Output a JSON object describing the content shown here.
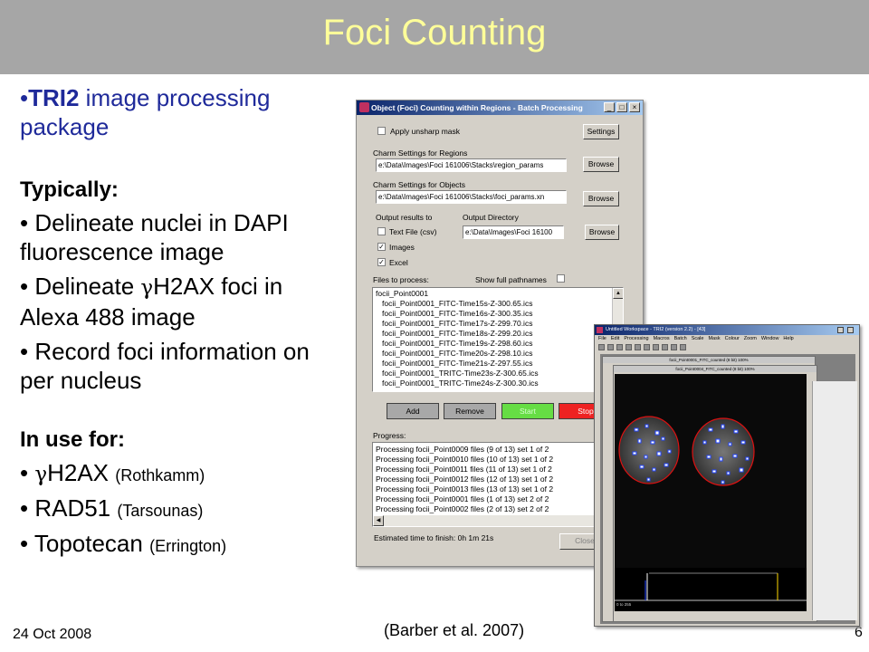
{
  "slide": {
    "title": "Foci Counting",
    "date": "24 Oct 2008",
    "citation": "(Barber et al. 2007)",
    "page_number": "6"
  },
  "left": {
    "intro_bullet": "•",
    "intro_bold": "TRI2",
    "intro_rest_1": " image processing",
    "intro_rest_2": "package",
    "typically_heading": "Typically:",
    "b1_line1": "• Delineate nuclei in DAPI",
    "b1_line2": "fluorescence image",
    "b2_prefix": "• Delineate ",
    "b2_gamma": "γ",
    "b2_rest": "H2AX foci in",
    "b2_line2": "Alexa 488 image",
    "b3_line1": "• Record foci information on",
    "b3_line2": "per nucleus",
    "inuse_heading": "In use for:",
    "u1_prefix": "• ",
    "u1_gamma": "γ",
    "u1_main": "H2AX ",
    "u1_small": "(Rothkamm)",
    "u2_main": "• RAD51 ",
    "u2_small": "(Tarsounas)",
    "u3_main": "• Topotecan ",
    "u3_small": "(Errington)"
  },
  "dialog": {
    "title": "Object (Foci) Counting within Regions - Batch Processing",
    "minimize": "_",
    "maximize": "□",
    "close": "×",
    "unsharp_label": "Apply unsharp mask",
    "settings_button": "Settings",
    "regions_label": "Charm Settings for Regions",
    "regions_value": "e:\\Data\\Images\\Foci 161006\\Stacks\\region_params",
    "browse_label": "Browse",
    "objects_label": "Charm Settings for Objects",
    "objects_value": "e:\\Data\\Images\\Foci 161006\\Stacks\\foci_params.xn",
    "output_results_label": "Output results to",
    "output_dir_label": "Output Directory",
    "textfile_label": "Text File (csv)",
    "images_label": "Images",
    "excel_label": "Excel",
    "output_dir_value": "e:\\Data\\Images\\Foci 16100",
    "files_label": "Files to process:",
    "show_full_label": "Show full pathnames",
    "files": [
      "focii_Point0001",
      "focii_Point0001_FITC-Time15s-Z-300.65.ics",
      "focii_Point0001_FITC-Time16s-Z-300.35.ics",
      "focii_Point0001_FITC-Time17s-Z-299.70.ics",
      "focii_Point0001_FITC-Time18s-Z-299.20.ics",
      "focii_Point0001_FITC-Time19s-Z-298.60.ics",
      "focii_Point0001_FITC-Time20s-Z-298.10.ics",
      "focii_Point0001_FITC-Time21s-Z-297.55.ics",
      "focii_Point0001_TRITC-Time23s-Z-300.65.ics",
      "focii_Point0001_TRITC-Time24s-Z-300.30.ics"
    ],
    "add_button": "Add",
    "remove_button": "Remove",
    "start_button": "Start",
    "stop_button": "Stop",
    "progress_label": "Progress:",
    "progress": [
      "Processing focii_Point0009 files (9 of 13) set 1 of 2",
      "Processing focii_Point0010 files (10 of 13) set 1 of 2",
      "Processing focii_Point0011 files (11 of 13) set 1 of 2",
      "Processing focii_Point0012 files (12 of 13) set 1 of 2",
      "Processing focii_Point0013 files (13 of 13) set 1 of 2",
      "Processing focii_Point0001 files (1 of 13) set 2 of 2",
      "Processing focii_Point0002 files (2 of 13) set 2 of 2"
    ],
    "estimate": "Estimated time to finish: 0h 1m 21s",
    "close_button": "Close",
    "colors": {
      "start_green": "#66dd44",
      "stop_red": "#ee2222"
    }
  },
  "tri2": {
    "title": "Untitled Workspace - TRI2 (version 2.2) - [43]",
    "menu": [
      "File",
      "Edit",
      "Processing",
      "Macros",
      "Batch",
      "Scale",
      "Mask",
      "Colour",
      "Zoom",
      "Window",
      "Help"
    ],
    "sub_title_1": "focii_Point0001_FITC_counted (8 bit) 100%",
    "sub_title_2": "focii_Point0004_FITC_counted (8 bit) 100%",
    "hist_label": "0 to 255"
  }
}
